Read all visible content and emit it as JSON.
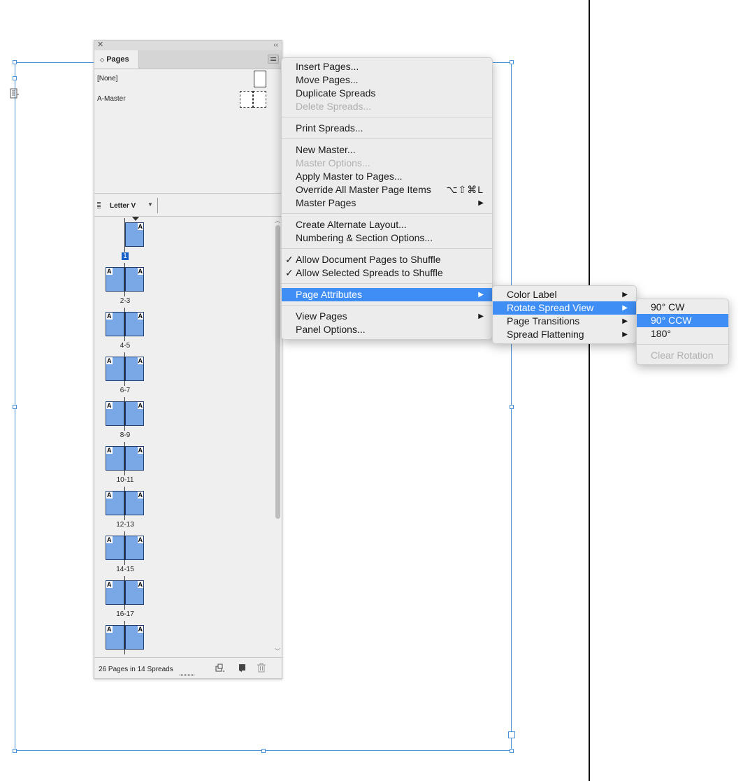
{
  "panel": {
    "close_glyph": "✕",
    "collapse_glyph": "‹‹",
    "tab_label": "Pages",
    "tab_icon": "◇",
    "masters": [
      {
        "label": "[None]"
      },
      {
        "label": "A-Master"
      }
    ],
    "page_size": "Letter V",
    "master_prefix": "A",
    "spreads": [
      {
        "label": "1",
        "pages": 1,
        "selected": true
      },
      {
        "label": "2-3",
        "pages": 2
      },
      {
        "label": "4-5",
        "pages": 2
      },
      {
        "label": "6-7",
        "pages": 2
      },
      {
        "label": "8-9",
        "pages": 2
      },
      {
        "label": "10-11",
        "pages": 2
      },
      {
        "label": "12-13",
        "pages": 2
      },
      {
        "label": "14-15",
        "pages": 2
      },
      {
        "label": "16-17",
        "pages": 2
      },
      {
        "label": "",
        "pages": 2
      }
    ],
    "status": "26 Pages in 14 Spreads",
    "footer_icons": [
      "edit-page-size-icon",
      "new-page-icon",
      "delete-page-icon"
    ],
    "page_fill_color": "#7aa8e6"
  },
  "menu_main": {
    "items": [
      {
        "label": "Insert Pages..."
      },
      {
        "label": "Move Pages..."
      },
      {
        "label": "Duplicate Spreads"
      },
      {
        "label": "Delete Spreads...",
        "disabled": true
      },
      {
        "separator": true
      },
      {
        "label": "Print Spreads..."
      },
      {
        "separator": true
      },
      {
        "label": "New Master..."
      },
      {
        "label": "Master Options...",
        "disabled": true
      },
      {
        "label": "Apply Master to Pages..."
      },
      {
        "label": "Override All Master Page Items",
        "shortcut": "⌥⇧⌘L"
      },
      {
        "label": "Master Pages",
        "submenu": true
      },
      {
        "separator": true
      },
      {
        "label": "Create Alternate Layout..."
      },
      {
        "label": "Numbering & Section Options..."
      },
      {
        "separator": true
      },
      {
        "label": "Allow Document Pages to Shuffle",
        "checked": true
      },
      {
        "label": "Allow Selected Spreads to Shuffle",
        "checked": true
      },
      {
        "separator": true
      },
      {
        "label": "Page Attributes",
        "submenu": true,
        "highlighted": true
      },
      {
        "separator": true
      },
      {
        "label": "View Pages",
        "submenu": true
      },
      {
        "label": "Panel Options..."
      }
    ]
  },
  "menu_attributes": {
    "items": [
      {
        "label": "Color Label",
        "submenu": true
      },
      {
        "label": "Rotate Spread View",
        "submenu": true,
        "highlighted": true
      },
      {
        "label": "Page Transitions",
        "submenu": true
      },
      {
        "label": "Spread Flattening",
        "submenu": true
      }
    ]
  },
  "menu_rotate": {
    "items": [
      {
        "label": "90° CW"
      },
      {
        "label": "90° CCW",
        "highlighted": true
      },
      {
        "label": "180°"
      },
      {
        "separator": true
      },
      {
        "label": "Clear Rotation",
        "disabled": true
      }
    ]
  },
  "glyphs": {
    "submenu_arrow": "▶",
    "check": "✓",
    "caret": "▼"
  },
  "colors": {
    "highlight": "#3f8ef5",
    "frame": "#4a90d9",
    "selected_label": "#1560c9"
  }
}
